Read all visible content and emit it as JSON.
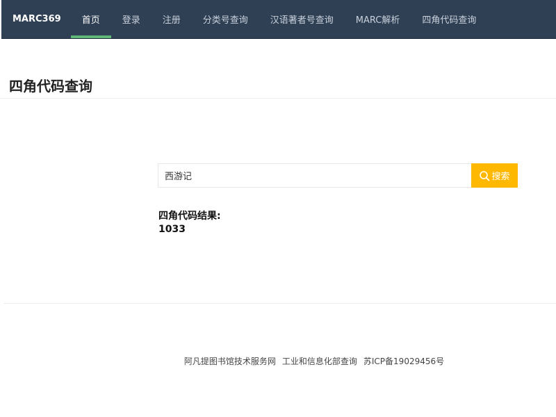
{
  "navbar": {
    "brand": "MARC369",
    "items": [
      {
        "label": "首页",
        "active": true
      },
      {
        "label": "登录"
      },
      {
        "label": "注册"
      },
      {
        "label": "分类号查询"
      },
      {
        "label": "汉语著者号查询"
      },
      {
        "label": "MARC解析"
      },
      {
        "label": "四角代码查询"
      }
    ]
  },
  "page": {
    "title": "四角代码查询"
  },
  "search": {
    "value": "西游记",
    "button_label": "搜索",
    "button_icon": "search-icon"
  },
  "result": {
    "label": "四角代码结果:",
    "value": "1033"
  },
  "footer": {
    "links": [
      "阿凡提图书馆技术服务网",
      "工业和信息化部查询",
      "苏ICP备19029456号"
    ]
  },
  "colors": {
    "navbar_bg": "#2f3f54",
    "active_underline": "#5fb878",
    "search_button": "#ffb800"
  }
}
